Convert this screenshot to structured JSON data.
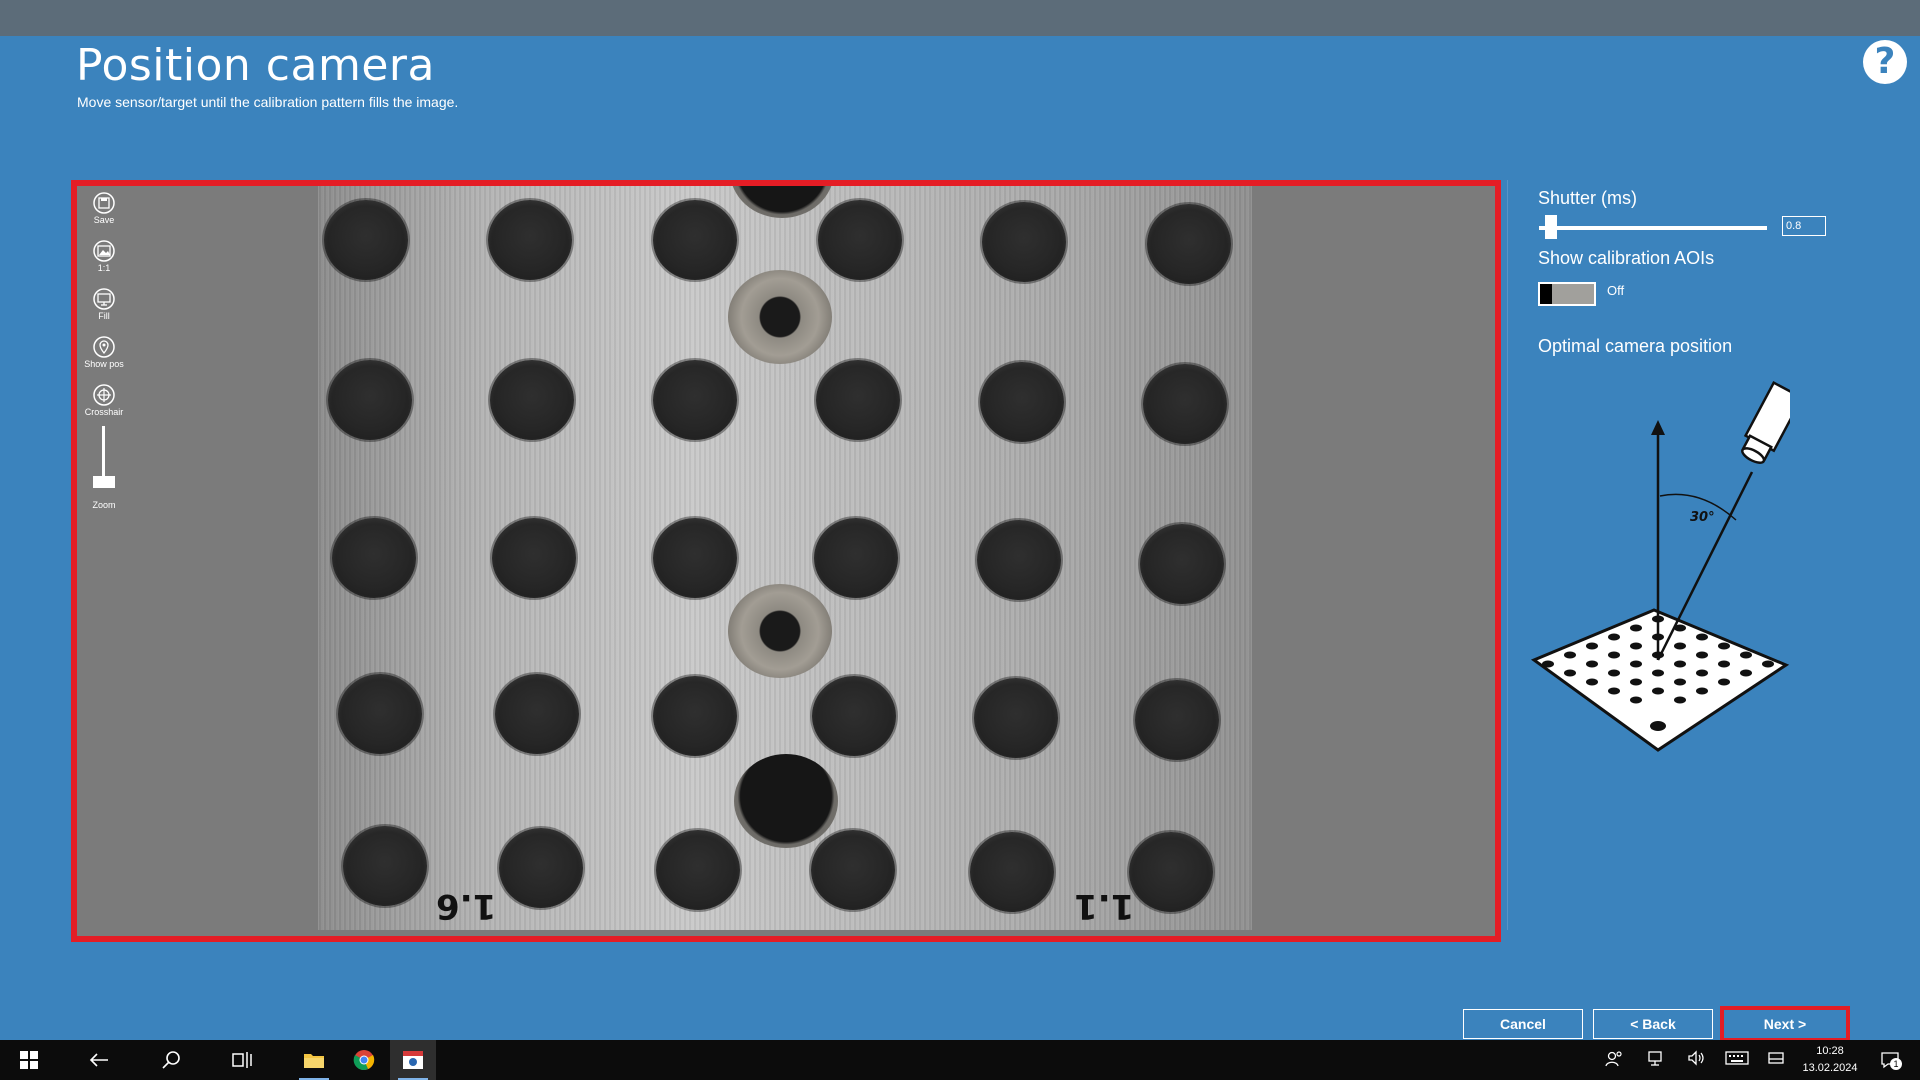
{
  "page": {
    "title": "Position camera",
    "subtitle": "Move sensor/target until the calibration pattern fills the image.",
    "help_icon_glyph": "?"
  },
  "viewer": {
    "tools": [
      {
        "label": "Save",
        "icon": "save-icon"
      },
      {
        "label": "1:1",
        "icon": "image-icon"
      },
      {
        "label": "Fill",
        "icon": "monitor-icon"
      },
      {
        "label": "Show pos",
        "icon": "location-pin-icon"
      },
      {
        "label": "Crosshair",
        "icon": "crosshair-icon"
      }
    ],
    "zoom_label": "Zoom",
    "plate_labels": [
      "1.6",
      "1.1"
    ]
  },
  "settings": {
    "shutter_label": "Shutter (ms)",
    "shutter_value": "0.8",
    "aoi_label": "Show calibration AOIs",
    "aoi_state": "Off",
    "optimal_label": "Optimal camera position",
    "angle_label": "30°"
  },
  "buttons": {
    "cancel": "Cancel",
    "back": "< Back",
    "next": "Next >"
  },
  "taskbar": {
    "time": "10:28",
    "date": "13.02.2024",
    "notification_count": "1"
  },
  "colors": {
    "background": "#3b83bd",
    "highlight": "#e41d25",
    "titlebar": "#5c6c79"
  }
}
